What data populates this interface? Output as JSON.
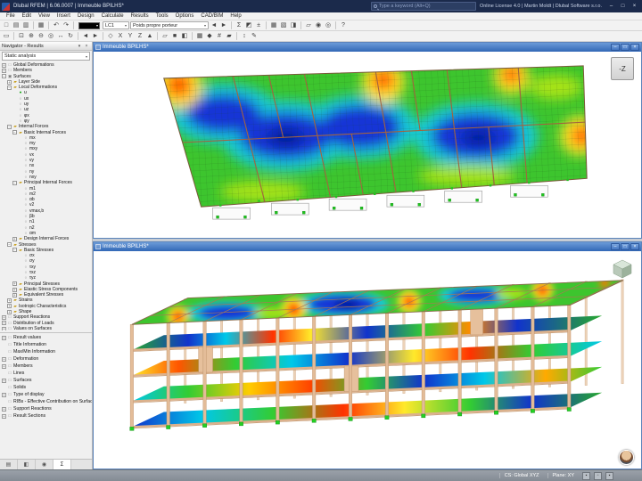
{
  "window": {
    "title": "Dlubal RFEM | 6.06.0007 | Immeuble BPILHS*",
    "search_placeholder": "Type a keyword (Alt+Q)",
    "license": "Online License 4.0 | Martin Moldt | Dlubal Software s.r.o.",
    "controls": [
      {
        "n": "minimize-button",
        "g": "–"
      },
      {
        "n": "maximize-button",
        "g": "□"
      },
      {
        "n": "close-button",
        "g": "×"
      }
    ]
  },
  "menus": [
    {
      "t": "File"
    },
    {
      "t": "Edit"
    },
    {
      "t": "View"
    },
    {
      "t": "Insert"
    },
    {
      "t": "Design"
    },
    {
      "t": "Calculate"
    },
    {
      "t": "Results"
    },
    {
      "t": "Tools"
    },
    {
      "t": "Options"
    },
    {
      "t": "CAD/BIM"
    },
    {
      "t": "Help"
    }
  ],
  "toolbar": {
    "load_case": "LC1",
    "load_case_name": "Poids propre porteur",
    "row1_left": [
      {
        "n": "new-model-icon",
        "g": "□"
      },
      {
        "n": "open-model-icon",
        "g": "▤"
      },
      {
        "n": "save-model-icon",
        "g": "▥"
      },
      {
        "c": "sep"
      },
      {
        "n": "print-icon",
        "g": "▦"
      },
      {
        "c": "sep"
      },
      {
        "n": "undo-icon",
        "g": "↶"
      },
      {
        "n": "redo-icon",
        "g": "↷"
      },
      {
        "c": "sep"
      }
    ],
    "row1_right": [
      {
        "n": "previous-load-case-icon",
        "g": "◄"
      },
      {
        "n": "next-load-case-icon",
        "g": "►"
      },
      {
        "c": "sep"
      },
      {
        "n": "calculate-all-icon",
        "g": "Σ"
      },
      {
        "n": "show-results-icon",
        "g": "◩"
      },
      {
        "n": "result-values-icon",
        "g": "±"
      },
      {
        "c": "sep"
      },
      {
        "n": "tables-icon",
        "g": "▦"
      },
      {
        "n": "printout-report-icon",
        "g": "▧"
      },
      {
        "n": "panel-icon",
        "g": "◨"
      },
      {
        "c": "sep"
      },
      {
        "n": "section-icon",
        "g": "▱"
      },
      {
        "n": "visibility-icon",
        "g": "◉"
      },
      {
        "n": "user-defined-visibility-icon",
        "g": "◎"
      },
      {
        "c": "sep"
      },
      {
        "n": "help-icon",
        "g": "?"
      }
    ],
    "row2": [
      {
        "n": "select-icon",
        "g": "▭"
      },
      {
        "c": "sep"
      },
      {
        "n": "zoom-window-icon",
        "g": "⊡"
      },
      {
        "n": "zoom-in-icon",
        "g": "⊕"
      },
      {
        "n": "zoom-out-icon",
        "g": "⊖"
      },
      {
        "n": "zoom-all-icon",
        "g": "◎"
      },
      {
        "n": "pan-icon",
        "g": "↔"
      },
      {
        "n": "orbit-icon",
        "g": "↻"
      },
      {
        "c": "sep"
      },
      {
        "n": "previous-view-icon",
        "g": "◄"
      },
      {
        "n": "next-view-icon",
        "g": "►"
      },
      {
        "c": "sep"
      },
      {
        "n": "isometric-view-icon",
        "g": "◇"
      },
      {
        "n": "view-in-x-icon",
        "g": "X"
      },
      {
        "n": "view-in-y-icon",
        "g": "Y"
      },
      {
        "n": "view-in-z-icon",
        "g": "Z"
      },
      {
        "n": "perspective-icon",
        "g": "▲"
      },
      {
        "c": "sep"
      },
      {
        "n": "wireframe-display-icon",
        "g": "▱"
      },
      {
        "n": "solid-display-icon",
        "g": "■"
      },
      {
        "n": "rendered-display-icon",
        "g": "◧"
      },
      {
        "c": "sep"
      },
      {
        "n": "grid-icon",
        "g": "▦"
      },
      {
        "n": "snap-icon",
        "g": "◆"
      },
      {
        "n": "guidelines-icon",
        "g": "#"
      },
      {
        "n": "work-plane-icon",
        "g": "▰"
      },
      {
        "c": "sep"
      },
      {
        "n": "move-copy-icon",
        "g": "↕"
      },
      {
        "n": "edit-mode-icon",
        "g": "✎"
      }
    ]
  },
  "navigator": {
    "title": "Navigator - Results",
    "analysis": "Static analysis",
    "tree": [
      {
        "n": "tree-item-global-deformations",
        "d": 0,
        "e": "+",
        "g": "□",
        "t": "Global Deformations"
      },
      {
        "n": "tree-item-members",
        "d": 0,
        "e": "+",
        "g": "□",
        "t": "Members"
      },
      {
        "n": "tree-item-surfaces",
        "d": 0,
        "e": "−",
        "g": "▣",
        "t": "Surfaces"
      },
      {
        "n": "tree-item-layer-side",
        "d": 1,
        "e": "+",
        "g": "▰",
        "c": "fld",
        "t": "Layer Side"
      },
      {
        "n": "tree-item-local-deformations",
        "d": 1,
        "e": "−",
        "g": "▰",
        "c": "fld",
        "t": "Local Deformations"
      },
      {
        "n": "tree-item-u",
        "d": 2,
        "e": "",
        "g": "●",
        "c": "sel",
        "t": "u"
      },
      {
        "n": "tree-item-ux",
        "d": 2,
        "e": "",
        "g": "○",
        "t": "ux"
      },
      {
        "n": "tree-item-uy",
        "d": 2,
        "e": "",
        "g": "○",
        "t": "uy"
      },
      {
        "n": "tree-item-uz",
        "d": 2,
        "e": "",
        "g": "○",
        "t": "uz"
      },
      {
        "n": "tree-item-phix",
        "d": 2,
        "e": "",
        "g": "○",
        "t": "φx"
      },
      {
        "n": "tree-item-phiy",
        "d": 2,
        "e": "",
        "g": "○",
        "t": "φy"
      },
      {
        "n": "tree-item-internal-forces",
        "d": 1,
        "e": "−",
        "g": "▰",
        "c": "fld",
        "t": "Internal Forces"
      },
      {
        "n": "tree-item-basic-internal-forces",
        "d": 2,
        "e": "−",
        "g": "▰",
        "c": "fld",
        "t": "Basic Internal Forces"
      },
      {
        "n": "tree-item-mx",
        "d": 3,
        "e": "",
        "g": "○",
        "t": "mx"
      },
      {
        "n": "tree-item-my",
        "d": 3,
        "e": "",
        "g": "○",
        "t": "my"
      },
      {
        "n": "tree-item-mxy",
        "d": 3,
        "e": "",
        "g": "○",
        "t": "mxy"
      },
      {
        "n": "tree-item-vx",
        "d": 3,
        "e": "",
        "g": "○",
        "t": "vx"
      },
      {
        "n": "tree-item-vy",
        "d": 3,
        "e": "",
        "g": "○",
        "t": "vy"
      },
      {
        "n": "tree-item-nx",
        "d": 3,
        "e": "",
        "g": "○",
        "t": "nx"
      },
      {
        "n": "tree-item-ny",
        "d": 3,
        "e": "",
        "g": "○",
        "t": "ny"
      },
      {
        "n": "tree-item-nxy",
        "d": 3,
        "e": "",
        "g": "○",
        "t": "nxy"
      },
      {
        "n": "tree-item-principal-internal-forces",
        "d": 2,
        "e": "−",
        "g": "▰",
        "c": "fld",
        "t": "Principal Internal Forces"
      },
      {
        "n": "tree-item-m1",
        "d": 3,
        "e": "",
        "g": "○",
        "t": "m1"
      },
      {
        "n": "tree-item-m2",
        "d": 3,
        "e": "",
        "g": "○",
        "t": "m2"
      },
      {
        "n": "tree-item-alphab",
        "d": 3,
        "e": "",
        "g": "○",
        "t": "αb"
      },
      {
        "n": "tree-item-v2",
        "d": 3,
        "e": "",
        "g": "○",
        "t": "v2"
      },
      {
        "n": "tree-item-vmaxb",
        "d": 3,
        "e": "",
        "g": "○",
        "t": "vmax,b"
      },
      {
        "n": "tree-item-betab",
        "d": 3,
        "e": "",
        "g": "○",
        "t": "βb"
      },
      {
        "n": "tree-item-n1",
        "d": 3,
        "e": "",
        "g": "○",
        "t": "n1"
      },
      {
        "n": "tree-item-n2",
        "d": 3,
        "e": "",
        "g": "○",
        "t": "n2"
      },
      {
        "n": "tree-item-alpham",
        "d": 3,
        "e": "",
        "g": "○",
        "t": "αm"
      },
      {
        "n": "tree-item-design-internal-forces",
        "d": 2,
        "e": "+",
        "g": "▰",
        "c": "fld",
        "t": "Design Internal Forces"
      },
      {
        "n": "tree-item-stresses",
        "d": 1,
        "e": "−",
        "g": "▰",
        "c": "fld",
        "t": "Stresses"
      },
      {
        "n": "tree-item-basic-stresses",
        "d": 2,
        "e": "−",
        "g": "▰",
        "c": "fld",
        "t": "Basic Stresses"
      },
      {
        "n": "tree-item-sigmax",
        "d": 3,
        "e": "",
        "g": "○",
        "t": "σx"
      },
      {
        "n": "tree-item-sigmay",
        "d": 3,
        "e": "",
        "g": "○",
        "t": "σy"
      },
      {
        "n": "tree-item-tauxy",
        "d": 3,
        "e": "",
        "g": "○",
        "t": "τxy"
      },
      {
        "n": "tree-item-tauxz",
        "d": 3,
        "e": "",
        "g": "○",
        "t": "τxz"
      },
      {
        "n": "tree-item-tauyz",
        "d": 3,
        "e": "",
        "g": "○",
        "t": "τyz"
      },
      {
        "n": "tree-item-principal-stresses",
        "d": 2,
        "e": "+",
        "g": "▰",
        "c": "fld",
        "t": "Principal Stresses"
      },
      {
        "n": "tree-item-elastic-stress-components",
        "d": 2,
        "e": "+",
        "g": "▰",
        "c": "fld",
        "t": "Elastic Stress Components"
      },
      {
        "n": "tree-item-equivalent-stresses",
        "d": 2,
        "e": "+",
        "g": "▰",
        "c": "fld",
        "t": "Equivalent Stresses"
      },
      {
        "n": "tree-item-strains",
        "d": 1,
        "e": "+",
        "g": "▰",
        "c": "fld",
        "t": "Strains"
      },
      {
        "n": "tree-item-isotropic-characteristics",
        "d": 1,
        "e": "+",
        "g": "▰",
        "c": "fld",
        "t": "Isotropic Characteristics"
      },
      {
        "n": "tree-item-shape",
        "d": 1,
        "e": "+",
        "g": "▰",
        "c": "fld",
        "t": "Shape"
      },
      {
        "n": "tree-item-support-reactions",
        "d": 0,
        "e": "+",
        "g": "□",
        "t": "Support Reactions"
      },
      {
        "n": "tree-item-distribution-of-loads",
        "d": 0,
        "e": "+",
        "g": "□",
        "t": "Distribution of Loads"
      },
      {
        "n": "tree-item-values-on-surfaces",
        "d": 0,
        "e": "+",
        "g": "□",
        "t": "Values on Surfaces"
      }
    ],
    "options": [
      {
        "n": "option-result-values",
        "d": 0,
        "e": "+",
        "g": "□",
        "t": "Result values"
      },
      {
        "n": "option-title-information",
        "d": 0,
        "e": "",
        "g": "□",
        "t": "Title Information"
      },
      {
        "n": "option-max-min-information",
        "d": 0,
        "e": "",
        "g": "□",
        "t": "Max/Min Information"
      },
      {
        "n": "option-deformation",
        "d": 0,
        "e": "+",
        "g": "□",
        "t": "Deformation"
      },
      {
        "n": "option-members",
        "d": 0,
        "e": "+",
        "g": "□",
        "t": "Members"
      },
      {
        "n": "option-lines",
        "d": 0,
        "e": "",
        "g": "□",
        "t": "Lines"
      },
      {
        "n": "option-surfaces",
        "d": 0,
        "e": "+",
        "g": "□",
        "t": "Surfaces"
      },
      {
        "n": "option-solids",
        "d": 0,
        "e": "",
        "g": "□",
        "t": "Solids"
      },
      {
        "n": "option-type-of-display",
        "d": 0,
        "e": "+",
        "g": "□",
        "t": "Type of display"
      },
      {
        "n": "option-ribs",
        "d": 0,
        "e": "",
        "g": "□",
        "t": "RIBs - Effective Contribution on Surface/Member"
      },
      {
        "n": "option-support-reactions",
        "d": 0,
        "e": "+",
        "g": "□",
        "t": "Support Reactions"
      },
      {
        "n": "option-result-sections",
        "d": 0,
        "e": "+",
        "g": "□",
        "t": "Result Sections"
      }
    ],
    "tabs": [
      {
        "n": "navigator-tab-data",
        "g": "▤"
      },
      {
        "n": "navigator-tab-display",
        "g": "◧"
      },
      {
        "n": "navigator-tab-views",
        "g": "◉"
      },
      {
        "n": "navigator-tab-results",
        "g": "Σ",
        "c": "act"
      }
    ]
  },
  "vp_controls": [
    {
      "n": "viewport-minimize-button",
      "g": "–"
    },
    {
      "n": "viewport-restore-button",
      "g": "□"
    },
    {
      "n": "viewport-close-button",
      "g": "×"
    }
  ],
  "viewports": [
    {
      "title": "Immeuble BPILHS*",
      "cube_label": "-Z"
    },
    {
      "title": "Immeuble BPILHS*"
    }
  ],
  "statusbar": {
    "segments": [
      {
        "n": "status-coordinate-system",
        "t": "CS: Global XYZ"
      },
      {
        "n": "status-work-plane",
        "t": "Plane: XY"
      }
    ],
    "toggles": [
      {
        "n": "snap-status-toggle",
        "g": "▪"
      },
      {
        "n": "grid-status-toggle",
        "g": "▫"
      },
      {
        "n": "object-snap-status-toggle",
        "g": "▪"
      }
    ]
  },
  "result_scale_colors": [
    "#001e9e",
    "#1536d6",
    "#17c9d6",
    "#3dc52e",
    "#a8e312",
    "#ffe92a",
    "#ff8c00",
    "#ff2d00"
  ]
}
